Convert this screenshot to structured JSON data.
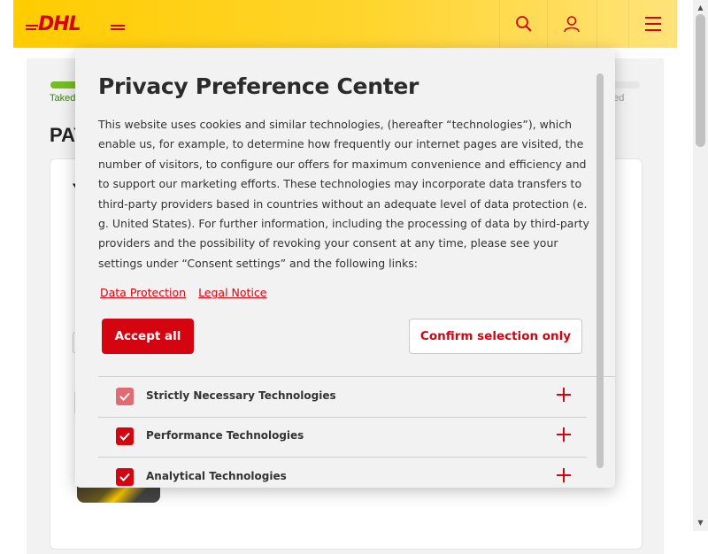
{
  "header": {
    "logo_alt": "DHL",
    "brand_color": "#ffcc00",
    "logo_color": "#d40511",
    "icons": [
      "search-icon",
      "user-icon",
      "menu-icon"
    ]
  },
  "background": {
    "progress_fraction": 0.05,
    "step_left": "Taked",
    "step_right": "eted",
    "heading_fragment": "PAY",
    "card_fragment": "Y"
  },
  "modal": {
    "title": "Privacy Preference Center",
    "description": "This website uses cookies and similar technologies, (hereafter “technologies”), which enable us, for example, to determine how frequently our internet pages are visited, the number of visitors, to configure our offers for maximum convenience and efficiency and to support our marketing efforts. These technologies may incorporate data transfers to third-party providers based in countries without an adequate level of data protection (e. g. United States). For further information, including the processing of data by third-party providers and the possibility of revoking your consent at any time, please see your settings under “Consent settings” and the following links:",
    "links": [
      "Data Protection",
      "Legal Notice"
    ],
    "accept_all_label": "Accept all",
    "confirm_label": "Confirm selection only",
    "accent_color": "#d40511",
    "categories": [
      {
        "label": "Strictly Necessary Technologies",
        "checked": true,
        "disabled": true
      },
      {
        "label": "Performance Technologies",
        "checked": true,
        "disabled": false
      },
      {
        "label": "Analytical Technologies",
        "checked": true,
        "disabled": false
      }
    ]
  }
}
